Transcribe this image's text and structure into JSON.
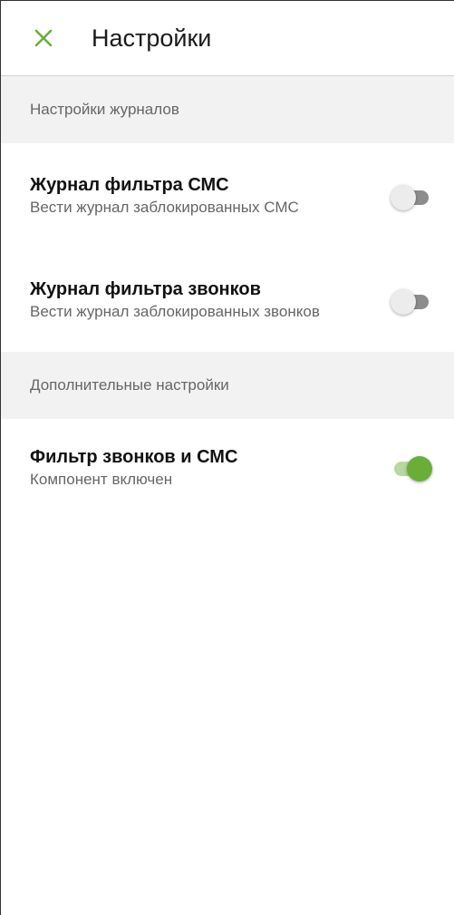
{
  "header": {
    "title": "Настройки",
    "close_icon": "close-icon",
    "accent_color": "#6aae38"
  },
  "sections": [
    {
      "header": "Настройки журналов",
      "items": [
        {
          "title": "Журнал фильтра СМС",
          "subtitle": "Вести журнал заблокированных СМС",
          "enabled": false
        },
        {
          "title": "Журнал фильтра звонков",
          "subtitle": "Вести журнал заблокированных звонков",
          "enabled": false
        }
      ]
    },
    {
      "header": "Дополнительные настройки",
      "items": [
        {
          "title": "Фильтр звонков и СМС",
          "subtitle": "Компонент включен",
          "enabled": true
        }
      ]
    }
  ]
}
